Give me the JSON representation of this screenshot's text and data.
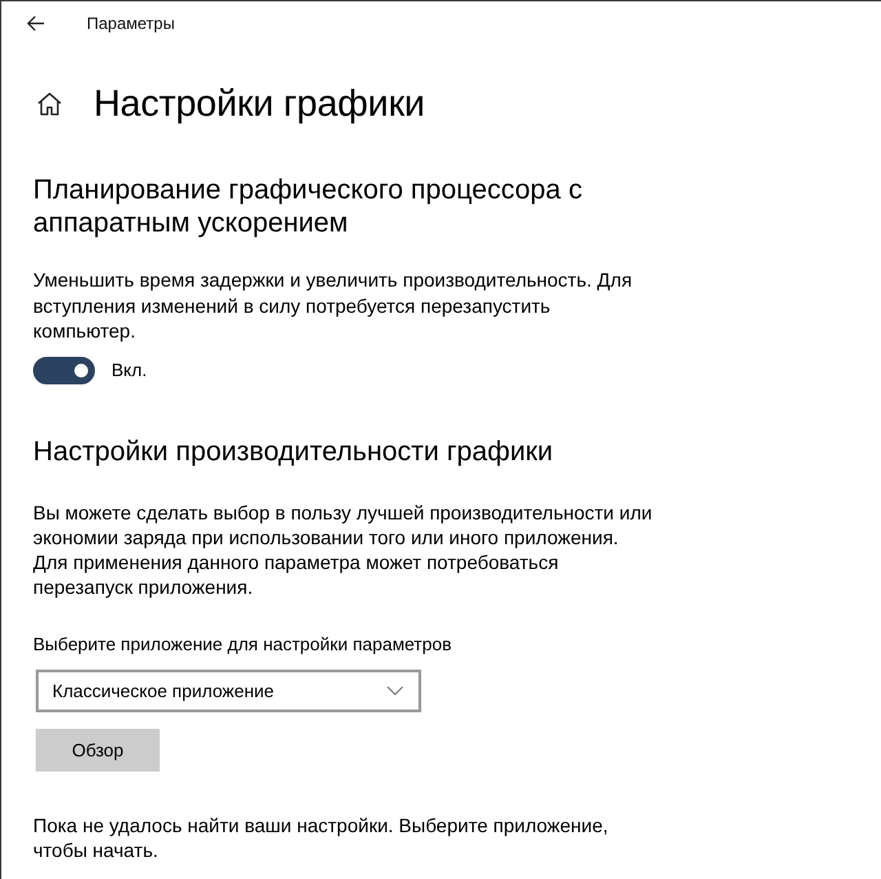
{
  "window": {
    "title": "Параметры"
  },
  "page": {
    "title": "Настройки графики"
  },
  "gpu_scheduling": {
    "heading": "Планирование графического процессора с аппаратным ускорением",
    "description": "Уменьшить время задержки и увеличить производительность. Для вступления изменений в силу потребуется перезапустить компьютер.",
    "toggle": {
      "on": true,
      "label": "Вкл."
    }
  },
  "performance": {
    "heading": "Настройки производительности графики",
    "description": "Вы можете сделать выбор в пользу лучшей производительности или экономии заряда при использовании того или иного приложения. Для применения данного параметра может потребоваться перезапуск приложения.",
    "select_label": "Выберите приложение для настройки параметров",
    "select": {
      "value": "Классическое приложение"
    },
    "browse_button": "Обзор",
    "empty_message": "Пока не удалось найти ваши настройки. Выберите приложение, чтобы начать."
  }
}
